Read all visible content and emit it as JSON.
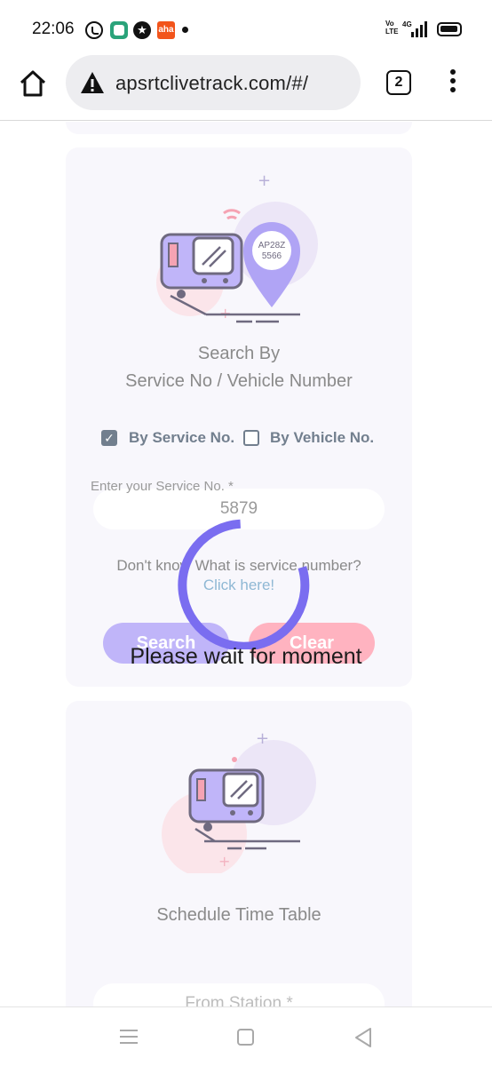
{
  "status_bar": {
    "time": "22:06",
    "volte_label": "Vo\nLTE",
    "network_label": "4G",
    "aha_label": "aha",
    "icons": [
      "whatsapp-icon",
      "app-icon",
      "star-icon",
      "aha-icon",
      "notification-dot",
      "volte-icon",
      "signal-icon",
      "battery-icon"
    ]
  },
  "browser": {
    "url": "apsrtclivetrack.com/#/",
    "tab_count": "2",
    "icons": [
      "home-icon",
      "warning-icon",
      "tabs-icon",
      "overflow-menu-icon"
    ]
  },
  "search_card": {
    "plate_number": "AP28Z\n5566",
    "title_line1": "Search By",
    "title_line2": "Service No / Vehicle Number",
    "option_service": {
      "label": "By Service No.",
      "checked": true
    },
    "option_vehicle": {
      "label": "By Vehicle No.",
      "checked": false
    },
    "field_label": "Enter your Service No. *",
    "field_value": "5879",
    "help_text": "Don't know What is service number?",
    "help_link": "Click here!",
    "search_button": "Search",
    "clear_button": "Clear"
  },
  "loader": {
    "text": "Please wait for moment"
  },
  "schedule_card": {
    "title": "Schedule Time Table",
    "from_placeholder": "From Station *"
  },
  "colors": {
    "accent_purple": "#7a6df0",
    "light_purple": "#c0b5f9",
    "pink": "#ffb3c0",
    "card_bg": "#f8f7fc",
    "muted_text": "#8a8a8a",
    "link": "#8fb8d4"
  },
  "nav_bar": {
    "icons": [
      "recent-apps-icon",
      "home-icon",
      "back-icon"
    ]
  }
}
